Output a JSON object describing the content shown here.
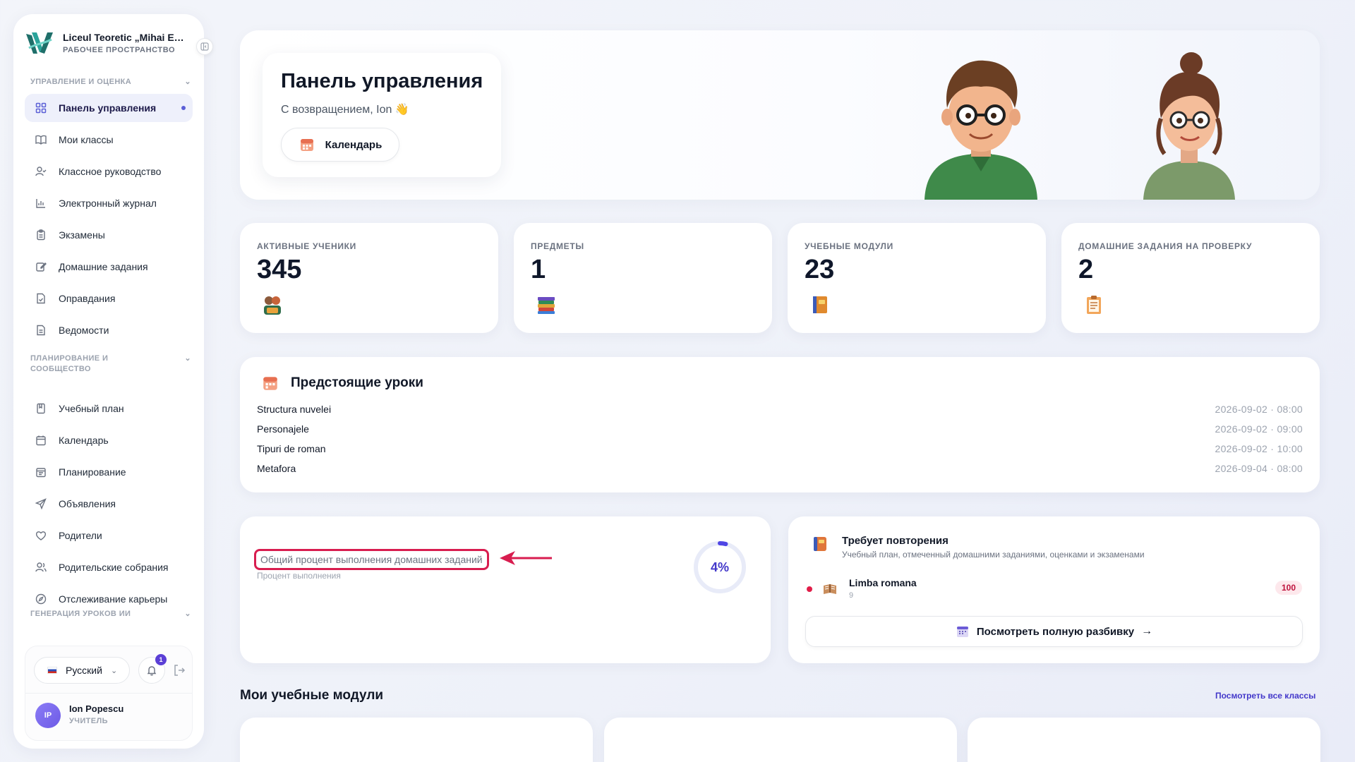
{
  "sidebar": {
    "brand_title": "Liceul Teoretic „Mihai Emi...",
    "brand_sub": "РАБОЧЕЕ ПРОСТРАНСТВО",
    "section1": "УПРАВЛЕНИЕ И ОЦЕНКА",
    "section2": "ПЛАНИРОВАНИЕ И СООБЩЕСТВО",
    "section3": "ГЕНЕРАЦИЯ УРОКОВ ИИ",
    "items": [
      {
        "label": "Панель управления",
        "icon": "grid-icon"
      },
      {
        "label": "Мои классы",
        "icon": "book-open-icon"
      },
      {
        "label": "Классное руководство",
        "icon": "user-check-icon"
      },
      {
        "label": "Электронный журнал",
        "icon": "bar-chart-icon"
      },
      {
        "label": "Экзамены",
        "icon": "clipboard-icon"
      },
      {
        "label": "Домашние задания",
        "icon": "edit-icon"
      },
      {
        "label": "Оправдания",
        "icon": "file-check-icon"
      },
      {
        "label": "Ведомости",
        "icon": "file-text-icon"
      },
      {
        "label": "Учебный план",
        "icon": "bookmark-book-icon"
      },
      {
        "label": "Календарь",
        "icon": "calendar-icon"
      },
      {
        "label": "Планирование",
        "icon": "calendar-list-icon"
      },
      {
        "label": "Объявления",
        "icon": "send-icon"
      },
      {
        "label": "Родители",
        "icon": "heart-icon"
      },
      {
        "label": "Родительские собрания",
        "icon": "users-icon"
      },
      {
        "label": "Отслеживание карьеры",
        "icon": "compass-icon"
      }
    ],
    "language": "Русский",
    "notif_count": "1",
    "user_initials": "IP",
    "user_name": "Ion Popescu",
    "user_role": "УЧИТЕЛЬ"
  },
  "hero": {
    "title": "Панель управления",
    "subtitle": "С возвращением, Ion 👋",
    "calendar_button": "Календарь"
  },
  "stats": [
    {
      "label": "АКТИВНЫЕ УЧЕНИКИ",
      "value": "345",
      "icon": "students-icon"
    },
    {
      "label": "ПРЕДМЕТЫ",
      "value": "1",
      "icon": "books-stack-icon"
    },
    {
      "label": "УЧЕБНЫЕ МОДУЛИ",
      "value": "23",
      "icon": "module-book-icon"
    },
    {
      "label": "ДОМАШНИЕ ЗАДАНИЯ НА ПРОВЕРКУ",
      "value": "2",
      "icon": "clipboard-task-icon"
    }
  ],
  "lessons": {
    "title": "Предстоящие уроки",
    "rows": [
      {
        "name": "Structura nuvelei",
        "time": "2026-09-02 · 08:00"
      },
      {
        "name": "Personajele",
        "time": "2026-09-02 · 09:00"
      },
      {
        "name": "Tipuri de roman",
        "time": "2026-09-02 · 10:00"
      },
      {
        "name": "Metafora",
        "time": "2026-09-04 · 08:00"
      }
    ]
  },
  "progress": {
    "label": "Общий процент выполнения домашних заданий",
    "sub": "Процент выполнения",
    "value_text": "4%",
    "fraction": 0.04,
    "highlight_color": "#d81d4f"
  },
  "repeat": {
    "title": "Требует повторения",
    "sub": "Учебный план, отмеченный домашними заданиями, оценками и экзаменами",
    "subject": "Limba romana",
    "grade": "9",
    "score": "100",
    "button": "Посмотреть полную разбивку"
  },
  "modules": {
    "title": "Мои учебные модули",
    "view_all": "Посмотреть все классы"
  },
  "colors": {
    "accent": "#5b5fd6",
    "ring_track": "#e8ebf8",
    "ring_fill": "#4f46e5"
  }
}
